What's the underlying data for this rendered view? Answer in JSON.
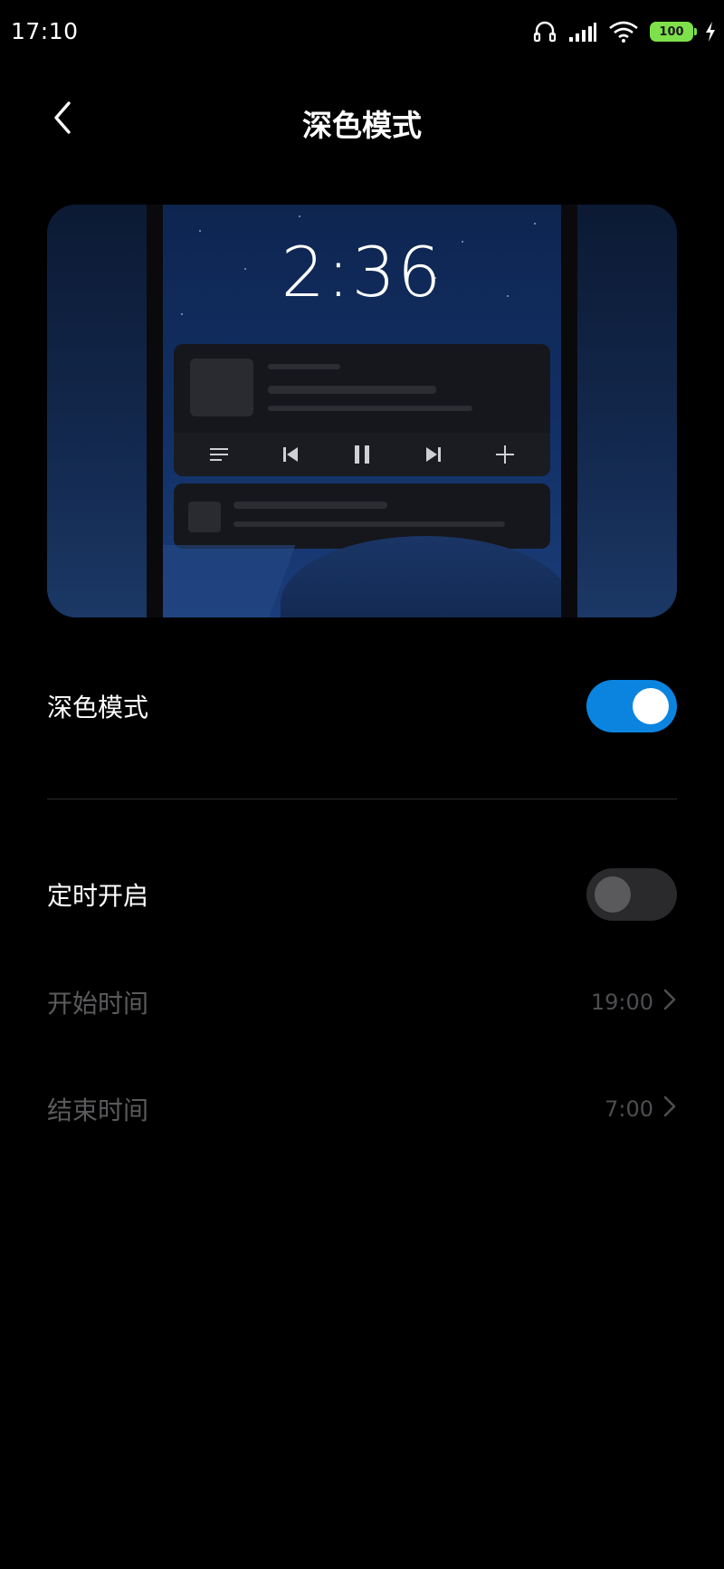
{
  "status_bar": {
    "time": "17:10",
    "battery": "100",
    "icons": [
      "headphones-icon",
      "signal-icon",
      "wifi-icon",
      "battery-icon",
      "charging-icon"
    ],
    "battery_color": "#7ee04a"
  },
  "header": {
    "back_icon": "chevron-left-icon",
    "title": "深色模式"
  },
  "preview": {
    "lock_time": "2:36",
    "media_controls": [
      "playlist-icon",
      "previous-icon",
      "pause-icon",
      "next-icon",
      "add-icon"
    ]
  },
  "settings": {
    "dark_mode": {
      "label": "深色模式",
      "enabled": true
    },
    "scheduled": {
      "label": "定时开启",
      "enabled": false
    },
    "start_time": {
      "label": "开始时间",
      "value": "19:00"
    },
    "end_time": {
      "label": "结束时间",
      "value": "7:00"
    }
  },
  "colors": {
    "accent": "#0b84e0",
    "background": "#000000",
    "disabled_text": "#5b5b5e"
  }
}
